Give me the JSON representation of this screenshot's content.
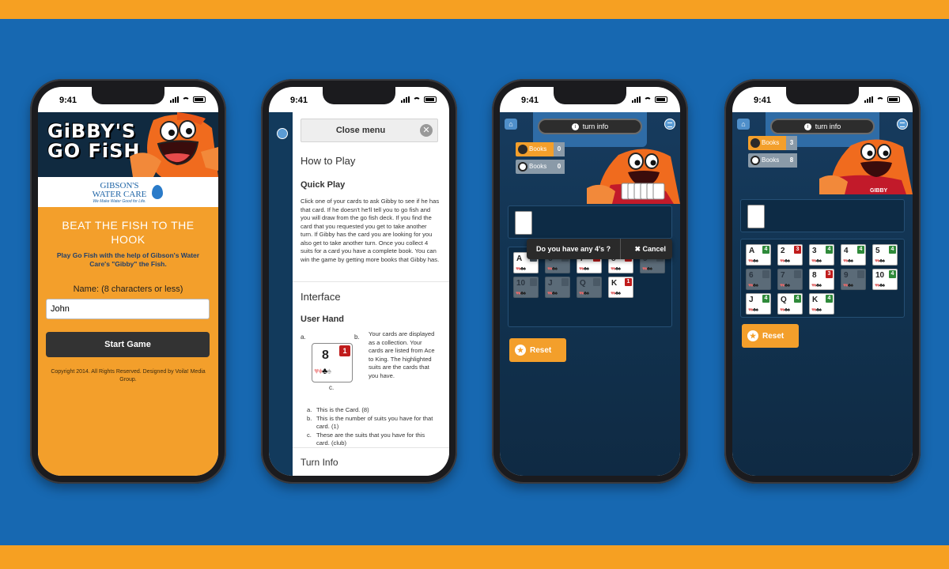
{
  "status_time": "9:41",
  "phone1": {
    "logo_title": "GiBBY'S GO FiSH",
    "brand_name": "GIBSON'S WATER CARE",
    "brand_tagline": "We Make Water Good for Life.",
    "headline": "BEAT THE FISH TO THE HOOK",
    "subhead": "Play Go Fish with the help of Gibson's Water Care's \"Gibby\" the Fish.",
    "name_label": "Name: (8 characters or less)",
    "name_value": "John",
    "start_button": "Start Game",
    "copyright": "Copyright 2014. All Rights Reserved. Designed by Voila! Media Group."
  },
  "phone2": {
    "close_menu": "Close menu",
    "how_to_play": "How to Play",
    "quick_play": "Quick Play",
    "quick_play_text": "Click one of your cards to ask Gibby to see if he has that card. If he doesn't he'll tell you to go fish and you will draw from the go fish deck. If you find the card that you requested you get to take another turn. If Gibby has the card you are looking for you also get to take another turn. Once you collect 4 suits for a card you have a complete book. You can win the game by getting more books that Gibby has.",
    "interface": "Interface",
    "user_hand": "User Hand",
    "figure": {
      "rank": "8",
      "badge": "1",
      "label_a": "a.",
      "label_b": "b.",
      "label_c": "c."
    },
    "user_hand_text": "Your cards are displayed as a collection. Your cards are listed from Ace to King. The highlighted suits are the cards that you have.",
    "list": [
      {
        "letter": "a.",
        "text": "This is the Card. (8)"
      },
      {
        "letter": "b.",
        "text": "This is the number of suits you have for that card. (1)"
      },
      {
        "letter": "c.",
        "text": "These are the suits that you have for this card. (club)"
      }
    ],
    "turn_info": "Turn Info"
  },
  "game": {
    "turn_info": "turn info",
    "books_label": "Books",
    "reset": "Reset",
    "gibby_label": "GIBBY",
    "colors": {
      "red_badge": "#c01c1c",
      "green_badge": "#2f8a3a",
      "orange": "#f39f2b"
    }
  },
  "phone3": {
    "user_books": "0",
    "gibby_books": "0",
    "prompt": "Do you have any 4's ?",
    "cancel": "Cancel",
    "cards": [
      {
        "rank": "A",
        "count": "",
        "dim": false
      },
      {
        "rank": "6",
        "count": "",
        "dim": true
      },
      {
        "rank": "7",
        "count": "1",
        "dim": false
      },
      {
        "rank": "8",
        "count": "1",
        "dim": false
      },
      {
        "rank": "9",
        "count": "",
        "dim": true
      },
      {
        "rank": "10",
        "count": "",
        "dim": true
      },
      {
        "rank": "J",
        "count": "",
        "dim": true
      },
      {
        "rank": "Q",
        "count": "",
        "dim": true
      },
      {
        "rank": "K",
        "count": "1",
        "dim": false
      }
    ]
  },
  "phone4": {
    "user_books": "3",
    "gibby_books": "8",
    "cards": [
      {
        "rank": "A",
        "count": "4",
        "dim": false,
        "color": "green"
      },
      {
        "rank": "2",
        "count": "3",
        "dim": false,
        "color": "red"
      },
      {
        "rank": "3",
        "count": "4",
        "dim": false,
        "color": "green"
      },
      {
        "rank": "4",
        "count": "4",
        "dim": false,
        "color": "green"
      },
      {
        "rank": "5",
        "count": "4",
        "dim": false,
        "color": "green"
      },
      {
        "rank": "6",
        "count": "",
        "dim": true,
        "color": ""
      },
      {
        "rank": "7",
        "count": "",
        "dim": true,
        "color": ""
      },
      {
        "rank": "8",
        "count": "3",
        "dim": false,
        "color": "red"
      },
      {
        "rank": "9",
        "count": "",
        "dim": true,
        "color": ""
      },
      {
        "rank": "10",
        "count": "4",
        "dim": false,
        "color": "green"
      },
      {
        "rank": "J",
        "count": "4",
        "dim": false,
        "color": "green"
      },
      {
        "rank": "Q",
        "count": "4",
        "dim": false,
        "color": "green"
      },
      {
        "rank": "K",
        "count": "4",
        "dim": false,
        "color": "green"
      }
    ]
  }
}
